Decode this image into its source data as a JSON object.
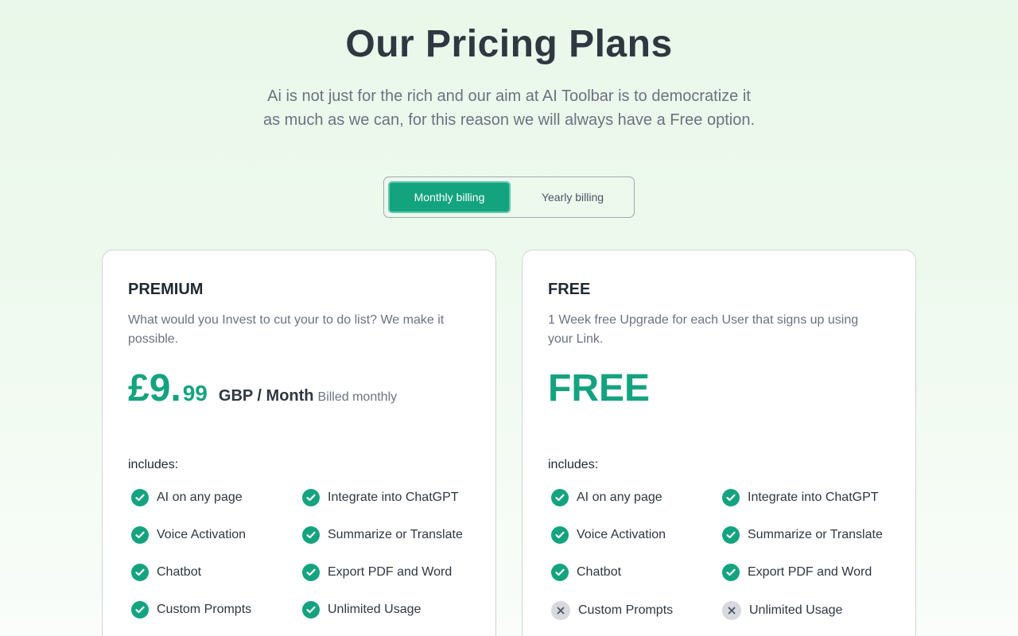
{
  "header": {
    "title": "Our Pricing Plans",
    "subtitle_line1": "Ai is not just for the rich and our aim at AI Toolbar is to democratize it",
    "subtitle_line2": "as much as we can, for this reason we will always have a Free option."
  },
  "billing_toggle": {
    "monthly_label": "Monthly billing",
    "yearly_label": "Yearly billing",
    "selected": "Monthly billing"
  },
  "colors": {
    "accent": "#14a37f",
    "text_dark": "#2f3740",
    "text_muted": "#6b7280",
    "unavailable_icon_bg": "#d7d9de"
  },
  "plans": [
    {
      "name": "PREMIUM",
      "description": "What would you Invest to cut your to do list? We make it possible.",
      "price_main": "£9.",
      "price_cents": "99",
      "price_unit": "GBP / Month",
      "price_note": "Billed monthly",
      "includes_label": "includes:",
      "features": [
        {
          "label": "AI on any page",
          "included": true,
          "icon": "check-circle-icon"
        },
        {
          "label": "Integrate into ChatGPT",
          "included": true,
          "icon": "check-circle-icon"
        },
        {
          "label": "Voice Activation",
          "included": true,
          "icon": "check-circle-icon"
        },
        {
          "label": "Summarize or Translate",
          "included": true,
          "icon": "check-circle-icon"
        },
        {
          "label": "Chatbot",
          "included": true,
          "icon": "check-circle-icon"
        },
        {
          "label": "Export PDF and Word",
          "included": true,
          "icon": "check-circle-icon"
        },
        {
          "label": "Custom Prompts",
          "included": true,
          "icon": "check-circle-icon"
        },
        {
          "label": "Unlimited Usage",
          "included": true,
          "icon": "check-circle-icon"
        }
      ]
    },
    {
      "name": "FREE",
      "description": "1 Week free Upgrade for each User that signs up using your Link.",
      "price_text": "FREE",
      "includes_label": "includes:",
      "features": [
        {
          "label": "AI on any page",
          "included": true,
          "icon": "check-circle-icon"
        },
        {
          "label": "Integrate into ChatGPT",
          "included": true,
          "icon": "check-circle-icon"
        },
        {
          "label": "Voice Activation",
          "included": true,
          "icon": "check-circle-icon"
        },
        {
          "label": "Summarize or Translate",
          "included": true,
          "icon": "check-circle-icon"
        },
        {
          "label": "Chatbot",
          "included": true,
          "icon": "check-circle-icon"
        },
        {
          "label": "Export PDF and Word",
          "included": true,
          "icon": "check-circle-icon"
        },
        {
          "label": "Custom Prompts",
          "included": false,
          "icon": "cross-circle-icon"
        },
        {
          "label": "Unlimited Usage",
          "included": false,
          "icon": "cross-circle-icon"
        }
      ]
    }
  ]
}
